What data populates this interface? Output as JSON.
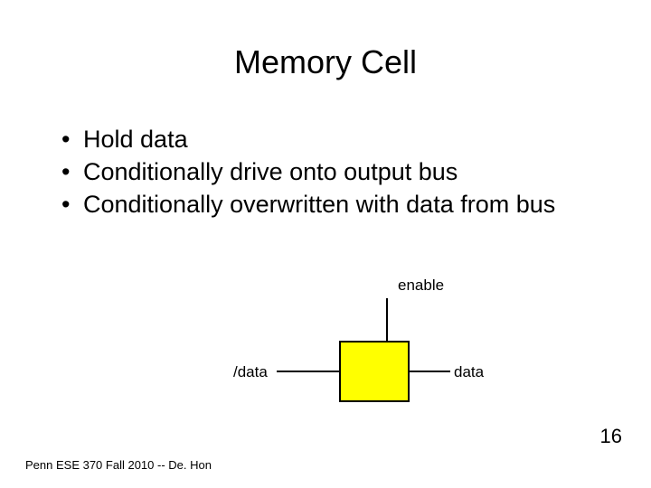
{
  "title": "Memory Cell",
  "bullets": [
    "Hold data",
    "Conditionally drive onto output bus",
    "Conditionally overwritten with data from bus"
  ],
  "diagram": {
    "enable_label": "enable",
    "data_inv_label": "/data",
    "data_label": "data"
  },
  "footer": "Penn ESE 370 Fall 2010 -- De. Hon",
  "page_number": "16"
}
